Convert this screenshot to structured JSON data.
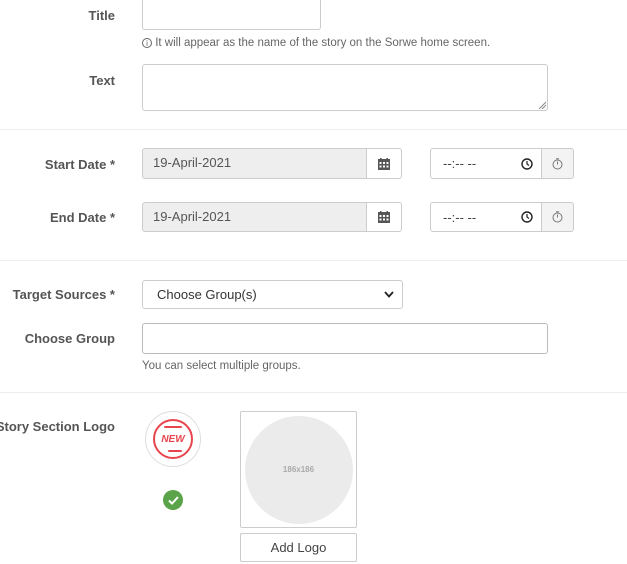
{
  "title_field": {
    "label": "Title",
    "value": "",
    "help": "It will appear as the name of the story on the Sorwe home screen."
  },
  "text_field": {
    "label": "Text",
    "value": ""
  },
  "start": {
    "label": "Start Date *",
    "date": "19-April-2021",
    "time": "--:-- --"
  },
  "end": {
    "label": "End Date *",
    "date": "19-April-2021",
    "time": "--:-- --"
  },
  "target": {
    "label": "Target Sources *",
    "selected": "Choose Group(s)"
  },
  "group": {
    "label": "Choose Group",
    "value": "",
    "help": "You can select multiple groups."
  },
  "logo": {
    "label": "Story Section Logo",
    "badge_text": "NEW",
    "placeholder_text": "186x186",
    "button_label": "Add Logo"
  },
  "colors": {
    "badge_red": "#e8454e",
    "check_green": "#5aa348",
    "input_disabled": "#eeeeee"
  }
}
